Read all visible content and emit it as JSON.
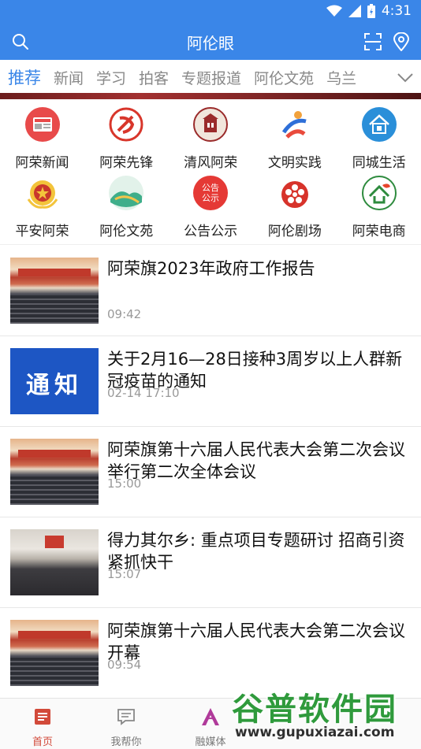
{
  "status": {
    "time": "4:31"
  },
  "header": {
    "title": "阿伦眼"
  },
  "tabs": [
    "推荐",
    "新闻",
    "学习",
    "拍客",
    "专题报道",
    "阿伦文苑",
    "乌兰"
  ],
  "grid": [
    {
      "label": "阿荣新闻",
      "icon": "news-icon",
      "color": "#e84a4a"
    },
    {
      "label": "阿荣先锋",
      "icon": "party-emblem-icon",
      "color": "#d8362b"
    },
    {
      "label": "清风阿荣",
      "icon": "building-seal-icon",
      "color": "#9a2b2b"
    },
    {
      "label": "文明实践",
      "icon": "runner-logo-icon",
      "color": "#2e6fd8"
    },
    {
      "label": "同城生活",
      "icon": "house-icon",
      "color": "#2a8fd9"
    },
    {
      "label": "平安阿荣",
      "icon": "police-badge-icon",
      "color": "#c9372c"
    },
    {
      "label": "阿伦文苑",
      "icon": "landscape-icon",
      "color": "#3fae8a"
    },
    {
      "label": "公告公示",
      "icon": "notice-icon",
      "color": "#e53935",
      "text": "公告\n公示"
    },
    {
      "label": "阿伦剧场",
      "icon": "film-reel-icon",
      "color": "#d7332b"
    },
    {
      "label": "阿荣电商",
      "icon": "leaf-home-icon",
      "color": "#2e8b3e"
    }
  ],
  "news": [
    {
      "title": "阿荣旗2023年政府工作报告",
      "time": "09:42",
      "thumb": "hall"
    },
    {
      "title": "关于2月16—28日接种3周岁以上人群新冠疫苗的通知",
      "time": "02-14 17:10",
      "thumb": "notice",
      "thumb_text": "通知"
    },
    {
      "title": "阿荣旗第十六届人民代表大会第二次会议举行第二次全体会议",
      "time": "15:00",
      "thumb": "hall"
    },
    {
      "title": "得力其尔乡: 重点项目专题研讨 招商引资紧抓快干",
      "time": "15:07",
      "thumb": "meeting"
    },
    {
      "title": "阿荣旗第十六届人民代表大会第二次会议开幕",
      "time": "09:54",
      "thumb": "hall"
    }
  ],
  "bottom_nav": [
    {
      "label": "首页",
      "active": true
    },
    {
      "label": "我帮你",
      "active": false
    },
    {
      "label": "融媒体",
      "active": false
    }
  ],
  "watermark": {
    "name": "谷普软件园",
    "url": "www.gupuxiazai.com"
  },
  "colors": {
    "brand": "#3a86e8",
    "active_nav": "#d24a3a"
  }
}
